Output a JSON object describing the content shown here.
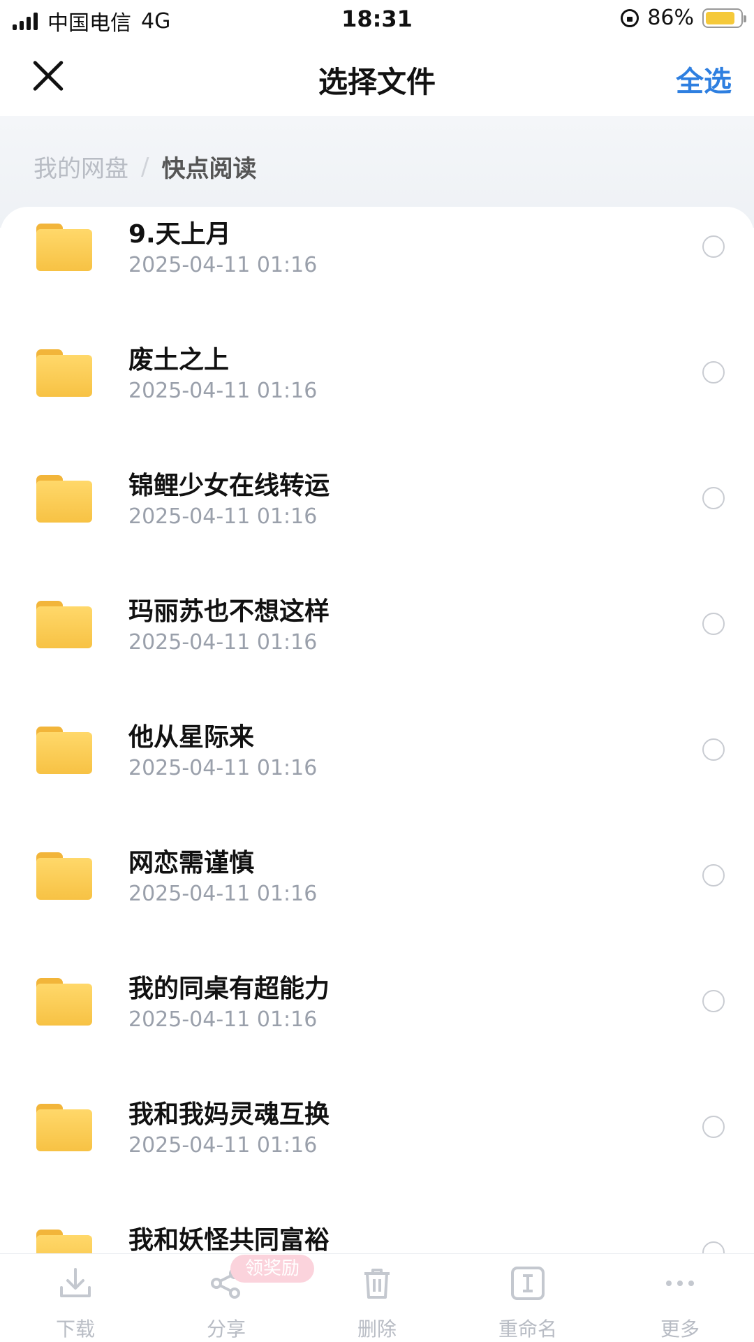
{
  "status": {
    "carrier": "中国电信",
    "network": "4G",
    "time": "18:31",
    "battery": "86%",
    "battery_level": 0.86
  },
  "header": {
    "title": "选择文件",
    "select_all": "全选"
  },
  "breadcrumb": {
    "root": "我的网盘",
    "sep": "/",
    "current": "快点阅读"
  },
  "files": [
    {
      "name": "9.天上月",
      "date": "2025-04-11 01:16"
    },
    {
      "name": "废土之上",
      "date": "2025-04-11 01:16"
    },
    {
      "name": "锦鲤少女在线转运",
      "date": "2025-04-11 01:16"
    },
    {
      "name": "玛丽苏也不想这样",
      "date": "2025-04-11 01:16"
    },
    {
      "name": "他从星际来",
      "date": "2025-04-11 01:16"
    },
    {
      "name": "网恋需谨慎",
      "date": "2025-04-11 01:16"
    },
    {
      "name": "我的同桌有超能力",
      "date": "2025-04-11 01:16"
    },
    {
      "name": "我和我妈灵魂互换",
      "date": "2025-04-11 01:16"
    },
    {
      "name": "我和妖怪共同富裕",
      "date": ""
    }
  ],
  "toolbar": {
    "download": "下载",
    "share": "分享",
    "share_badge": "领奖励",
    "delete": "删除",
    "rename": "重命名",
    "more": "更多"
  },
  "colors": {
    "accent": "#2e7fe0",
    "folder": "#f7c244",
    "muted": "#9aa0ab"
  }
}
